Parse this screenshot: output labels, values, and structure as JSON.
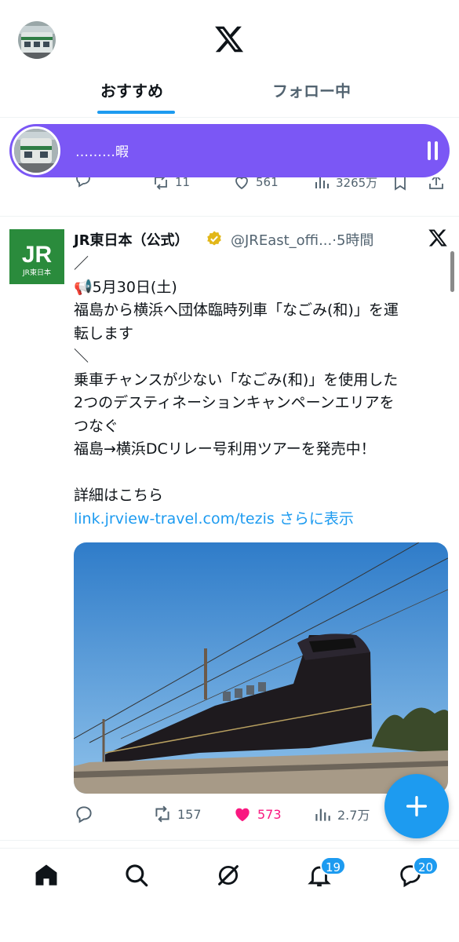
{
  "header": {
    "tabs": [
      {
        "label": "おすすめ",
        "active": true
      },
      {
        "label": "フォロー中",
        "active": false
      }
    ]
  },
  "space": {
    "title": "………暇"
  },
  "previous_tweet": {
    "retweets": "11",
    "likes": "561",
    "views": "3265万"
  },
  "tweet": {
    "author_name": "JR東日本（公式）",
    "author_handle": "@JREast_offi...",
    "time": "5時間",
    "avatar_text": "JR",
    "avatar_subtext": "JR東日本",
    "lines": [
      "／",
      "📢5月30日(土)",
      "福島から横浜へ団体臨時列車「なごみ(和)」を運",
      "転します",
      "＼",
      "乗車チャンスが少ない「なごみ(和)」を使用した",
      "2つのデスティネーションキャンペーンエリアを",
      "つなぐ",
      "福島→横浜DCリレー号利用ツアーを発売中！",
      "",
      "詳細はこちら"
    ],
    "link": "link.jrview-travel.com/tezis",
    "show_more": "さらに表示",
    "retweets": "157",
    "likes": "573",
    "views": "2.7万"
  },
  "nav": {
    "notifications_badge": "19",
    "messages_badge": "20"
  },
  "colors": {
    "accent": "#1d9bf0",
    "space": "#7b57f5",
    "like": "#f91880",
    "jr_green": "#2a8b3c"
  }
}
